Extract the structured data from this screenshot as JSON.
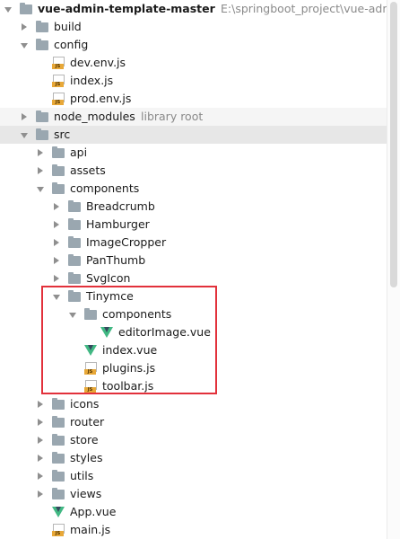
{
  "project_tree": {
    "rows": [
      {
        "label": "vue-admin-template-master",
        "secondary": "E:\\springboot_project\\vue-admin-temp",
        "icon": "folder-icon",
        "expanded": true,
        "depth": 0,
        "bold": true
      },
      {
        "label": "build",
        "icon": "folder-icon",
        "expanded": false,
        "depth": 1
      },
      {
        "label": "config",
        "icon": "folder-icon",
        "expanded": true,
        "depth": 1
      },
      {
        "label": "dev.env.js",
        "icon": "js-file-icon",
        "depth": 2,
        "leaf": true
      },
      {
        "label": "index.js",
        "icon": "js-file-icon",
        "depth": 2,
        "leaf": true
      },
      {
        "label": "prod.env.js",
        "icon": "js-file-icon",
        "depth": 2,
        "leaf": true
      },
      {
        "label": "node_modules",
        "secondary": "library root",
        "icon": "folder-icon",
        "expanded": false,
        "depth": 1,
        "highlight": "hover"
      },
      {
        "label": "src",
        "icon": "folder-icon",
        "expanded": true,
        "depth": 1,
        "highlight": "selected"
      },
      {
        "label": "api",
        "icon": "folder-icon",
        "expanded": false,
        "depth": 2
      },
      {
        "label": "assets",
        "icon": "folder-icon",
        "expanded": false,
        "depth": 2
      },
      {
        "label": "components",
        "icon": "folder-icon",
        "expanded": true,
        "depth": 2
      },
      {
        "label": "Breadcrumb",
        "icon": "folder-icon",
        "expanded": false,
        "depth": 3
      },
      {
        "label": "Hamburger",
        "icon": "folder-icon",
        "expanded": false,
        "depth": 3
      },
      {
        "label": "ImageCropper",
        "icon": "folder-icon",
        "expanded": false,
        "depth": 3
      },
      {
        "label": "PanThumb",
        "icon": "folder-icon",
        "expanded": false,
        "depth": 3
      },
      {
        "label": "SvgIcon",
        "icon": "folder-icon",
        "expanded": false,
        "depth": 3
      },
      {
        "label": "Tinymce",
        "icon": "folder-icon",
        "expanded": true,
        "depth": 3
      },
      {
        "label": "components",
        "icon": "folder-icon",
        "expanded": true,
        "depth": 4
      },
      {
        "label": "editorImage.vue",
        "icon": "vue-file-icon",
        "depth": 5,
        "leaf": true
      },
      {
        "label": "index.vue",
        "icon": "vue-file-icon",
        "depth": 4,
        "leaf": true
      },
      {
        "label": "plugins.js",
        "icon": "js-file-icon",
        "depth": 4,
        "leaf": true
      },
      {
        "label": "toolbar.js",
        "icon": "js-file-icon",
        "depth": 4,
        "leaf": true
      },
      {
        "label": "icons",
        "icon": "folder-icon",
        "expanded": false,
        "depth": 2
      },
      {
        "label": "router",
        "icon": "folder-icon",
        "expanded": false,
        "depth": 2
      },
      {
        "label": "store",
        "icon": "folder-icon",
        "expanded": false,
        "depth": 2
      },
      {
        "label": "styles",
        "icon": "folder-icon",
        "expanded": false,
        "depth": 2
      },
      {
        "label": "utils",
        "icon": "folder-icon",
        "expanded": false,
        "depth": 2
      },
      {
        "label": "views",
        "icon": "folder-icon",
        "expanded": false,
        "depth": 2
      },
      {
        "label": "App.vue",
        "icon": "vue-file-icon",
        "depth": 2,
        "leaf": true
      },
      {
        "label": "main.js",
        "icon": "js-file-icon",
        "depth": 2,
        "leaf": true
      }
    ]
  },
  "file_badges": {
    "js": "JS"
  },
  "colors": {
    "folder": "#9aa7b0",
    "js_badge": "#e8a838",
    "vue_green": "#41b883",
    "vue_dark": "#35495e",
    "annotation_box": "#e2313b",
    "selected_row": "#e7e7e7",
    "hover_row": "#f5f5f5"
  }
}
